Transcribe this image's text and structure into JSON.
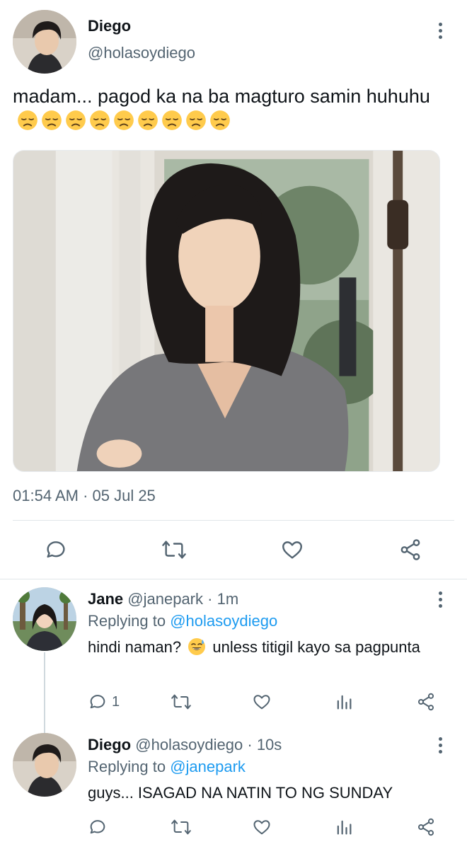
{
  "main_tweet": {
    "author_name": "Diego",
    "author_handle": "@holasoydiego",
    "text": "madam... pagod ka na ba magturo samin huhuhu",
    "emoji_count": 9,
    "timestamp": "01:54 AM · 05 Jul 25"
  },
  "replies": [
    {
      "author_name": "Jane",
      "author_handle": "@janepark",
      "time": "· 1m",
      "replying_prefix": "Replying to",
      "replying_handle": "@holasoydiego",
      "text_before_emoji": "hindi naman?",
      "text_after_emoji": "unless titigil kayo sa pagpunta",
      "reply_count": "1"
    },
    {
      "author_name": "Diego",
      "author_handle": "@holasoydiego",
      "time": "· 10s",
      "replying_prefix": "Replying to",
      "replying_handle": "@janepark",
      "text": "guys... ISAGAD NA NATIN TO NG SUNDAY"
    }
  ],
  "colors": {
    "text_primary": "#0f1419",
    "text_secondary": "#536471",
    "link": "#1d9bf0",
    "divider": "#e1e6ea"
  },
  "icons": [
    "more-vertical-icon",
    "reply-icon",
    "retweet-icon",
    "like-icon",
    "share-icon",
    "stats-icon",
    "disappointed-face-emoji",
    "sweat-smile-emoji"
  ]
}
